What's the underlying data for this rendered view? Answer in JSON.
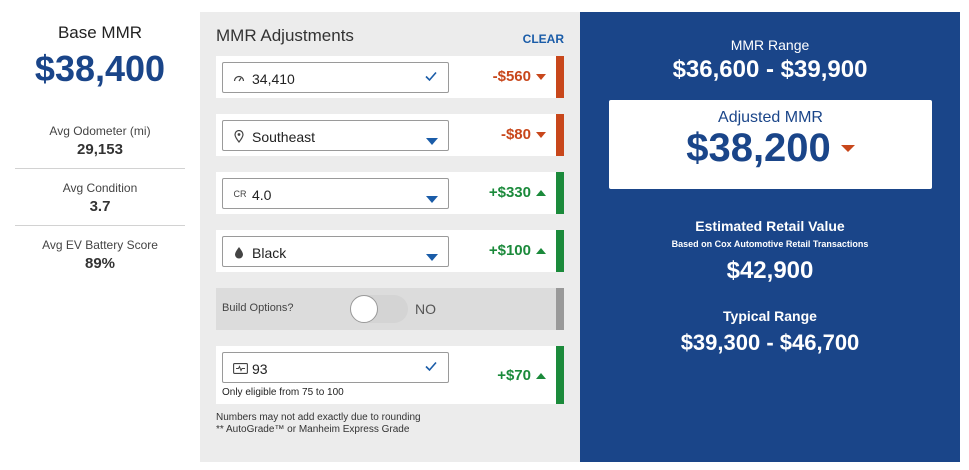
{
  "left": {
    "base_label": "Base MMR",
    "base_value": "$38,400",
    "stats": [
      {
        "label": "Avg Odometer (mi)",
        "value": "29,153"
      },
      {
        "label": "Avg Condition",
        "value": "3.7"
      },
      {
        "label": "Avg EV Battery Score",
        "value": "89%"
      }
    ]
  },
  "adjustments": {
    "title": "MMR Adjustments",
    "clear_label": "CLEAR",
    "rows": [
      {
        "icon": "odometer-icon",
        "value": "34,410",
        "control": "check",
        "amount": "-$560",
        "direction": "down",
        "bar": "#c8471b"
      },
      {
        "icon": "location-pin-icon",
        "value": "Southeast",
        "control": "dropdown",
        "amount": "-$80",
        "direction": "down",
        "bar": "#c8471b"
      },
      {
        "icon": "cr-icon",
        "icon_text": "CR",
        "value": "4.0",
        "control": "dropdown",
        "amount": "+$330",
        "direction": "up",
        "bar": "#1b8a3b"
      },
      {
        "icon": "paint-drop-icon",
        "value": "Black",
        "control": "dropdown",
        "amount": "+$100",
        "direction": "up",
        "bar": "#1b8a3b"
      }
    ],
    "build_options": {
      "label": "Build Options?",
      "toggle_text": "NO"
    },
    "battery": {
      "icon": "battery-icon",
      "value": "93",
      "hint": "Only eligible from 75 to 100",
      "amount": "+$70",
      "direction": "up"
    },
    "footnote_1": "Numbers may not add exactly due to rounding",
    "footnote_2": "** AutoGrade™ or Manheim Express Grade"
  },
  "summary": {
    "range_label": "MMR Range",
    "range_value": "$36,600 - $39,900",
    "adjusted_label": "Adjusted MMR",
    "adjusted_value": "$38,200",
    "retail_label": "Estimated Retail Value",
    "retail_sub": "Based on Cox Automotive Retail Transactions",
    "retail_value": "$42,900",
    "typical_label": "Typical Range",
    "typical_value": "$39,300 - $46,700"
  },
  "colors": {
    "brand_blue": "#1a4589",
    "negative": "#c8471b",
    "positive": "#1b8a3b"
  }
}
